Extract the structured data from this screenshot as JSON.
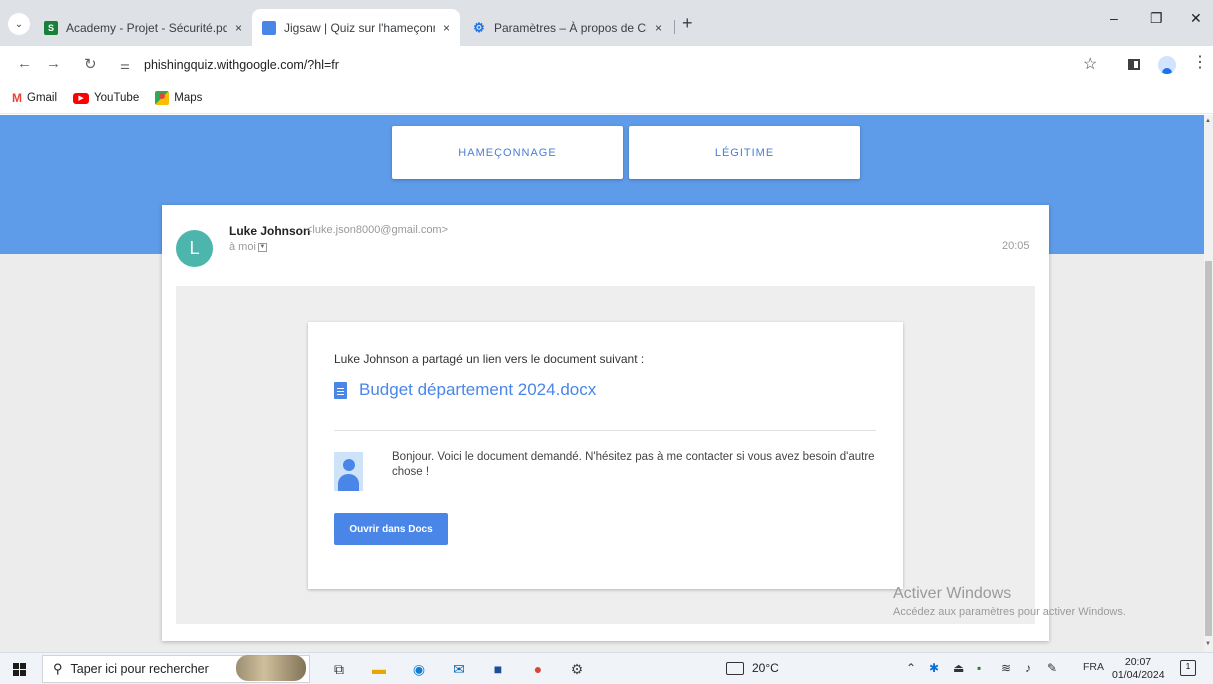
{
  "browser": {
    "tabs": [
      {
        "title": "Academy - Projet - Sécurité.pd",
        "close": "×",
        "favicon_color": "#188038",
        "favicon_letter": "S"
      },
      {
        "title": "Jigsaw | Quiz sur l'hameçonnag",
        "close": "×",
        "favicon_color": "#4a86e8",
        "favicon_letter": ""
      },
      {
        "title": "Paramètres – À propos de Chro",
        "close": "×",
        "favicon_color": "#1a73e8",
        "favicon_letter": "⚙"
      }
    ],
    "new_tab": "+",
    "window_controls": {
      "minimize": "–",
      "restore": "❐",
      "close": "✕"
    },
    "url": "phishingquiz.withgoogle.com/?hl=fr",
    "bookmarks": [
      {
        "label": "Gmail"
      },
      {
        "label": "YouTube"
      },
      {
        "label": "Maps"
      }
    ]
  },
  "quiz": {
    "buttons": {
      "phishing": "HAMEÇONNAGE",
      "legitimate": "LÉGITIME"
    }
  },
  "email": {
    "avatar_letter": "L",
    "sender_name": "Luke Johnson",
    "sender_email": "<luke.json8000@gmail.com>",
    "recipient": "à moi",
    "time": "20:05",
    "share_text": "Luke Johnson a partagé un lien vers le document suivant :",
    "document_name": "Budget département 2024.docx",
    "message": "Bonjour. Voici le document demandé. N'hésitez pas à me contacter si vous avez besoin d'autre chose !",
    "open_button": "Ouvrir dans Docs"
  },
  "watermark": {
    "title": "Activer Windows",
    "subtitle": "Accédez aux paramètres pour activer Windows."
  },
  "taskbar": {
    "search_placeholder": "Taper ici pour rechercher",
    "weather": "20°C",
    "language": "FRA",
    "time": "20:07",
    "date": "01/04/2024",
    "notification_count": "1"
  },
  "colors": {
    "hero_blue": "#5e9be8",
    "link_blue": "#4a86e8",
    "avatar_teal": "#4db6ac"
  }
}
